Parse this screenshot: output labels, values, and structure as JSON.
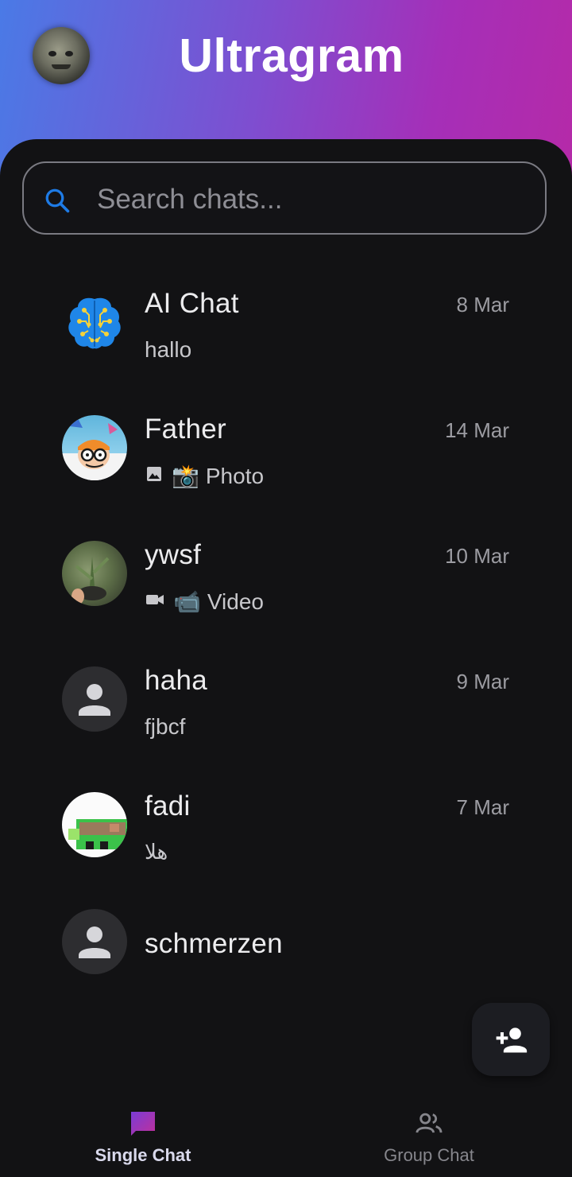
{
  "app": {
    "title": "Ultragram"
  },
  "search": {
    "placeholder": "Search chats..."
  },
  "chats": [
    {
      "name": "AI Chat",
      "date": "8 Mar",
      "preview": "hallo",
      "avatar": "ai-brain"
    },
    {
      "name": "Father",
      "date": "14 Mar",
      "preview": "Photo",
      "preview_icon": "image-icon",
      "preview_emoji": "📸",
      "avatar": "photo"
    },
    {
      "name": "ywsf",
      "date": "10 Mar",
      "preview": "Video",
      "preview_icon": "videocam-icon",
      "preview_emoji": "📹",
      "avatar": "photo"
    },
    {
      "name": "haha",
      "date": "9 Mar",
      "preview": "fjbcf",
      "avatar": "default-person"
    },
    {
      "name": "fadi",
      "date": "7 Mar",
      "preview": "هلا",
      "avatar": "photo"
    },
    {
      "name": "schmerzen",
      "date": "",
      "preview": "",
      "avatar": "default-person"
    }
  ],
  "fab": {
    "icon": "person-add-icon"
  },
  "bottom_nav": {
    "items": [
      {
        "label": "Single Chat",
        "icon": "chat-bubble-icon",
        "active": true
      },
      {
        "label": "Group Chat",
        "icon": "group-icon",
        "active": false
      }
    ]
  },
  "colors": {
    "header_gradient_start": "#4a7ae6",
    "header_gradient_end": "#b52aa8",
    "background": "#121214",
    "search_icon": "#1e7be6"
  }
}
